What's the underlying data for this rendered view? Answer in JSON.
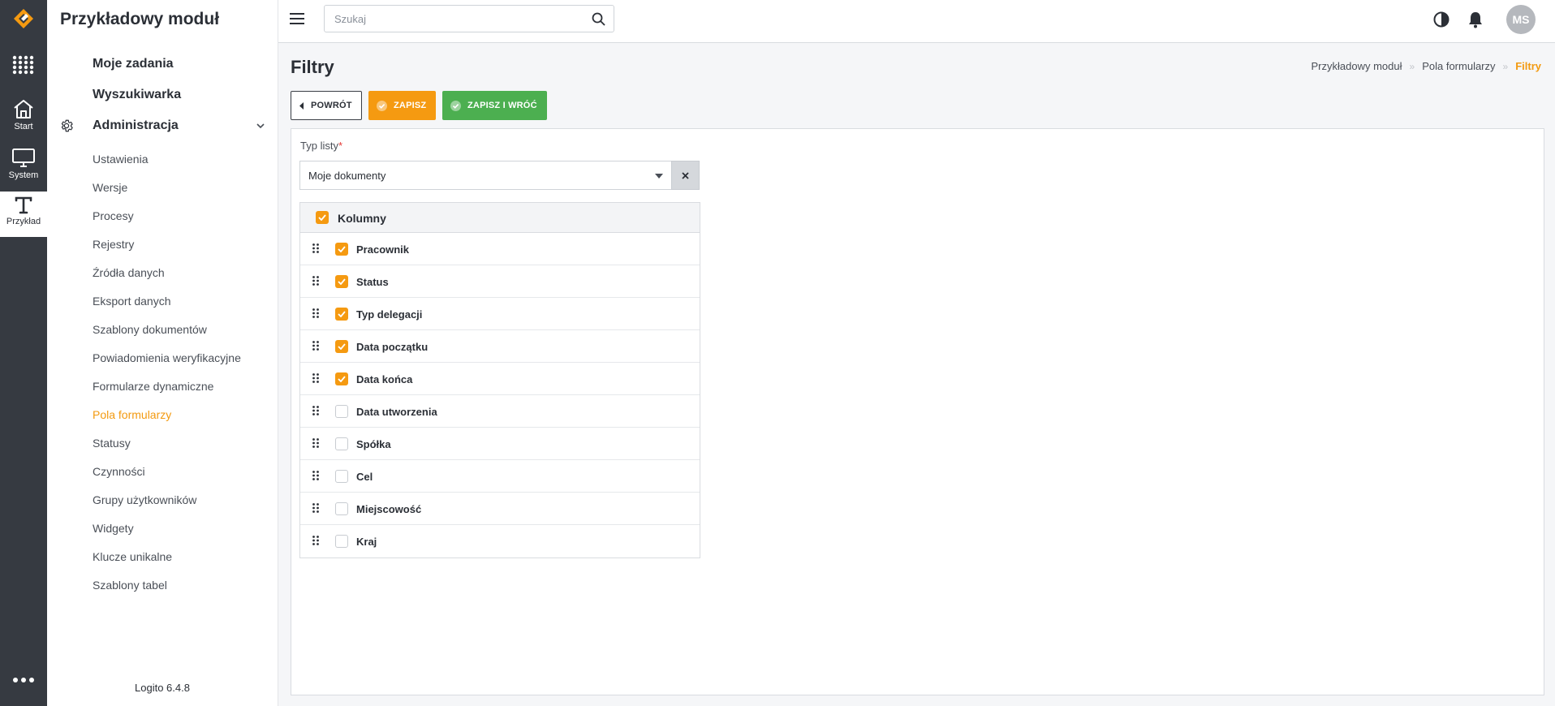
{
  "rail": {
    "items": [
      {
        "label": "Start",
        "icon": "home-icon"
      },
      {
        "label": "System",
        "icon": "monitor-icon"
      },
      {
        "label": "Przykład",
        "icon": "text-t-icon"
      }
    ]
  },
  "sidebar": {
    "title": "Przykładowy moduł",
    "main_items": [
      "Moje zadania",
      "Wyszukiwarka",
      "Administracja"
    ],
    "sub_items": [
      "Ustawienia",
      "Wersje",
      "Procesy",
      "Rejestry",
      "Źródła danych",
      "Eksport danych",
      "Szablony dokumentów",
      "Powiadomienia weryfikacyjne",
      "Formularze dynamiczne",
      "Pola formularzy",
      "Statusy",
      "Czynności",
      "Grupy użytkowników",
      "Widgety",
      "Klucze unikalne",
      "Szablony tabel"
    ],
    "active_sub_item": "Pola formularzy",
    "version": "Logito 6.4.8"
  },
  "topbar": {
    "search_placeholder": "Szukaj",
    "avatar_initials": "MS"
  },
  "page": {
    "title": "Filtry",
    "breadcrumb": [
      "Przykładowy moduł",
      "Pola formularzy",
      "Filtry"
    ]
  },
  "actions": {
    "back": "POWRÓT",
    "save": "ZAPISZ",
    "save_back": "ZAPISZ I WRÓĆ"
  },
  "form": {
    "list_type_label": "Typ listy",
    "required_mark": "*",
    "list_type_value": "Moje dokumenty",
    "columns_header": "Kolumny",
    "columns": [
      {
        "label": "Pracownik",
        "checked": true
      },
      {
        "label": "Status",
        "checked": true
      },
      {
        "label": "Typ delegacji",
        "checked": true
      },
      {
        "label": "Data początku",
        "checked": true
      },
      {
        "label": "Data końca",
        "checked": true
      },
      {
        "label": "Data utworzenia",
        "checked": false
      },
      {
        "label": "Spółka",
        "checked": false
      },
      {
        "label": "Cel",
        "checked": false
      },
      {
        "label": "Miejscowość",
        "checked": false
      },
      {
        "label": "Kraj",
        "checked": false
      }
    ]
  },
  "colors": {
    "accent": "#f59a11",
    "success": "#4caf50",
    "rail_bg": "#363a41"
  }
}
